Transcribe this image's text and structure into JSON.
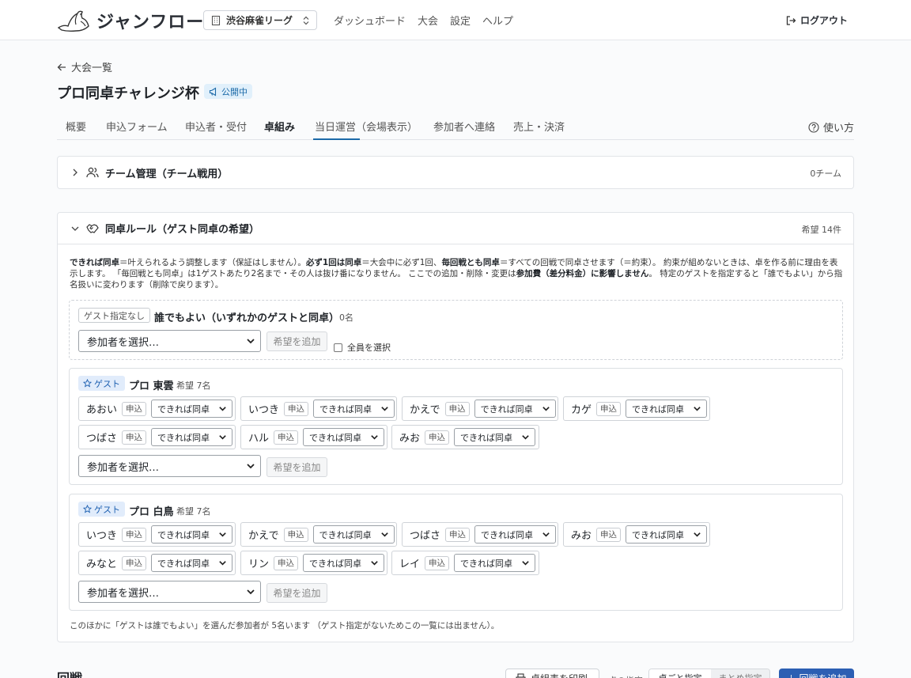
{
  "app": {
    "logo_text": "ジャンフロー",
    "org": "渋谷麻雀リーグ",
    "nav": [
      "ダッシュボード",
      "大会",
      "設定",
      "ヘルプ"
    ],
    "logout": "ログアウト"
  },
  "page": {
    "back": "大会一覧",
    "title": "プロ同卓チャレンジ杯",
    "status": "公開中",
    "tabs": [
      "概要",
      "申込フォーム",
      "申込者・受付",
      "卓組み",
      "当日運営（会場表示）",
      "参加者へ連絡",
      "売上・決済"
    ],
    "help": "使い方"
  },
  "team_panel": {
    "title": "チーム管理（チーム戦用）",
    "count": "0チーム"
  },
  "rule_panel": {
    "title": "同卓ルール（ゲスト同卓の希望）",
    "count": "希望 14件",
    "desc": {
      "p1b": "できれば同卓",
      "p1": "＝叶えられるよう調整します（保証はしません）。",
      "p2b": "必ず1回は同卓",
      "p2": "＝大会中に必ず1回、",
      "p3b": "毎回戦とも同卓",
      "p3": "＝すべての回戦で同卓させます（＝約束）。 約束が組めないときは、卓を作る前に理由を表示します。 「毎回戦とも同卓」は1ゲストあたり2名まで・その人は抜け番になりません。 ここでの追加・削除・変更は",
      "p4b": "参加費（差分料金）に影響しません",
      "p4": "。 特定のゲストを指定すると「誰でもよい」から指名扱いに変わります（削除で戻ります）。"
    },
    "any_group": {
      "tag": "ゲスト指定なし",
      "name": "誰でもよい（いずれかのゲストと同卓）",
      "count": "0名",
      "select_placeholder": "参加者を選択…",
      "add_label": "希望を追加",
      "select_all": "全員を選択"
    },
    "guest_tag": "ゲスト",
    "member_tag": "申込",
    "pref_value": "できれば同卓",
    "select_placeholder": "参加者を選択…",
    "add_label": "希望を追加",
    "guests": [
      {
        "name": "プロ 東雲",
        "count": "希望 7名",
        "members": [
          "あおい",
          "いつき",
          "かえで",
          "カゲ",
          "つばさ",
          "ハル",
          "みお"
        ]
      },
      {
        "name": "プロ 白鳥",
        "count": "希望 7名",
        "members": [
          "いつき",
          "かえで",
          "つばさ",
          "みお",
          "みなと",
          "リン",
          "レイ"
        ]
      }
    ],
    "footnote": "このほかに「ゲストは誰でもよい」を選んだ参加者が 5名います （ゲスト指定がないためこの一覧には出ません）。"
  },
  "rounds": {
    "title": "回戦",
    "print": "卓組表を印刷",
    "label1": "卓の指定",
    "opt1": "卓ごと指定",
    "opt2": "まとめ指定",
    "add_round": "回戦を追加"
  },
  "colors": {
    "accent": "#1c6aa8",
    "guest_tag_bg": "#e1ecfb",
    "public_badge_bg": "#e1f0fb"
  }
}
